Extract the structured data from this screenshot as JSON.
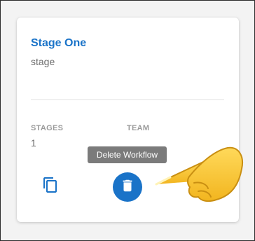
{
  "card": {
    "title": "Stage One",
    "subtitle": "stage",
    "stats": [
      {
        "label": "STAGES",
        "value": "1"
      },
      {
        "label": "TEAM",
        "value": ""
      }
    ]
  },
  "actions": {
    "copy_icon": "copy-icon",
    "delete_icon": "trash-icon",
    "tooltip": "Delete Workflow"
  },
  "colors": {
    "accent": "#1a73c8",
    "tooltip_bg": "#7b7b7b",
    "pointer": "#f6c431"
  }
}
